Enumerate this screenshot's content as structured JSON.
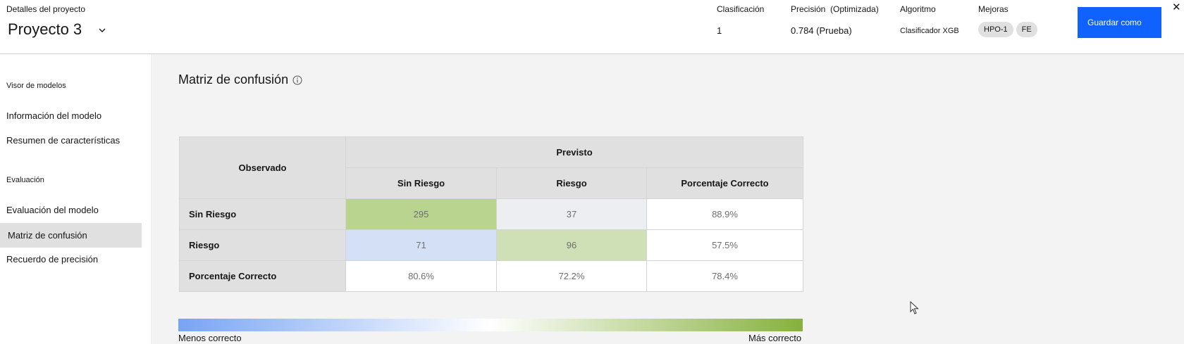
{
  "header": {
    "project_label": "Detalles del proyecto",
    "project_name": "Proyecto 3",
    "chevron_icon": "chevron-down-icon",
    "rank_label": "Clasificación",
    "rank_value": "1",
    "precision_label": "Precisión  (Optimizada)",
    "precision_value": "0.784 (Prueba)",
    "algorithm_label": "Algoritmo",
    "algorithm_value": "Clasificador XGB",
    "enhancements_label": "Mejoras",
    "tags": [
      "HPO-1",
      "FE"
    ],
    "save_label": "Guardar como",
    "close_glyph": "✕",
    "close_icon": "close-icon"
  },
  "sidebar": {
    "section1_title": "Visor de modelos",
    "section1_items": [
      "Información del modelo",
      "Resumen de características"
    ],
    "section2_title": "Evaluación",
    "section2_items": [
      "Evaluación del modelo",
      "Matriz de confusión",
      "Recuerdo de precisión"
    ],
    "active_item": "Matriz de confusión"
  },
  "main": {
    "title": "Matriz de confusión",
    "info_icon": "info-icon",
    "table": {
      "observed_header": "Observado",
      "predicted_header": "Previsto",
      "columns": [
        "Sin Riesgo",
        "Riesgo",
        "Porcentaje Correcto"
      ],
      "rows": [
        {
          "label": "Sin Riesgo",
          "cells": [
            "295",
            "37",
            "88.9%"
          ]
        },
        {
          "label": "Riesgo",
          "cells": [
            "71",
            "96",
            "57.5%"
          ]
        },
        {
          "label": "Porcentaje Correcto",
          "cells": [
            "80.6%",
            "72.2%",
            "78.4%"
          ]
        }
      ]
    },
    "legend_low": "Menos correcto",
    "legend_high": "Más correcto"
  },
  "colors": {
    "accent": "#0f62fe",
    "cell_high_green": "#b8d48f",
    "cell_mid_green": "#cfe0b6",
    "cell_light_blue": "#d4e0f5",
    "cell_neutral": "#eceef2",
    "scale_low": "#78a4f5",
    "scale_mid": "#ffffff",
    "scale_high": "#86b13c"
  }
}
